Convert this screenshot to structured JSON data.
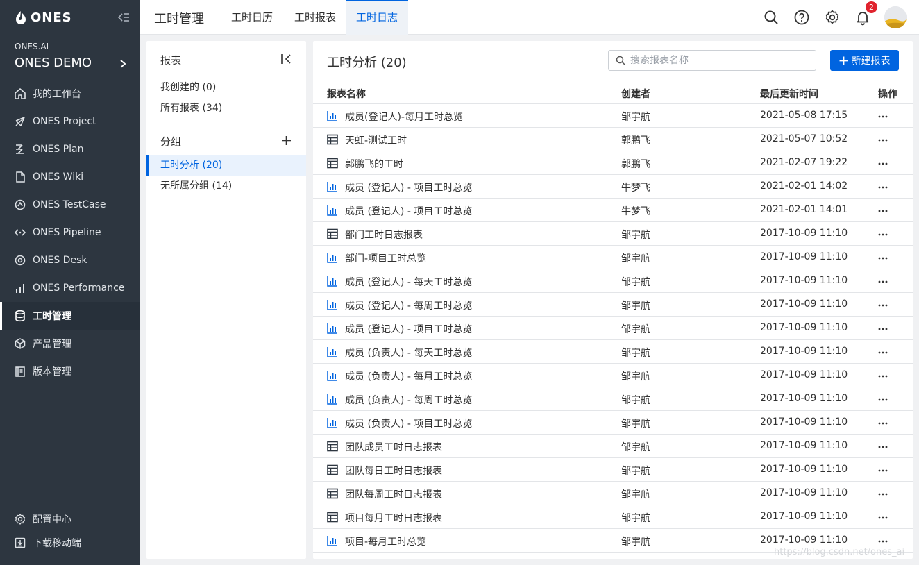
{
  "sidebar": {
    "logo": "ONES",
    "org": "ONES.AI",
    "team": "ONES DEMO",
    "items": [
      {
        "label": "我的工作台",
        "icon": "home-icon"
      },
      {
        "label": "ONES Project",
        "icon": "project-icon"
      },
      {
        "label": "ONES Plan",
        "icon": "plan-icon"
      },
      {
        "label": "ONES Wiki",
        "icon": "wiki-icon"
      },
      {
        "label": "ONES TestCase",
        "icon": "testcase-icon"
      },
      {
        "label": "ONES Pipeline",
        "icon": "pipeline-icon"
      },
      {
        "label": "ONES Desk",
        "icon": "desk-icon"
      },
      {
        "label": "ONES Performance",
        "icon": "performance-icon"
      },
      {
        "label": "工时管理",
        "icon": "database-icon",
        "active": true
      },
      {
        "label": "产品管理",
        "icon": "cube-icon"
      },
      {
        "label": "版本管理",
        "icon": "version-icon"
      }
    ],
    "bottom": [
      {
        "label": "配置中心",
        "icon": "gear-icon"
      },
      {
        "label": "下载移动端",
        "icon": "download-icon"
      }
    ]
  },
  "topbar": {
    "title": "工时管理",
    "tabs": [
      "工时日历",
      "工时报表",
      "工时日志"
    ],
    "active_tab": 2,
    "notification_count": "2"
  },
  "left_panel": {
    "reports_heading": "报表",
    "mine": "我创建的 (0)",
    "all": "所有报表 (34)",
    "groups_heading": "分组",
    "groups": [
      "工时分析 (20)",
      "无所属分组 (14)"
    ],
    "active_group": 0
  },
  "main": {
    "title": "工时分析 (20)",
    "search_placeholder": "搜索报表名称",
    "new_button": "新建报表",
    "columns": [
      "报表名称",
      "创建者",
      "最后更新时间",
      "操作"
    ],
    "rows": [
      {
        "type": "chart",
        "name": "成员(登记人)-每月工时总览",
        "creator": "邹宇航",
        "updated": "2021-05-08 17:15"
      },
      {
        "type": "table",
        "name": "天虹-测试工时",
        "creator": "郭鹏飞",
        "updated": "2021-05-07 10:52"
      },
      {
        "type": "table",
        "name": "郭鹏飞的工时",
        "creator": "郭鹏飞",
        "updated": "2021-02-07 19:22"
      },
      {
        "type": "chart",
        "name": "成员 (登记人) - 项目工时总览",
        "creator": "牛梦飞",
        "updated": "2021-02-01 14:02"
      },
      {
        "type": "chart",
        "name": "成员 (登记人) - 项目工时总览",
        "creator": "牛梦飞",
        "updated": "2021-02-01 14:01"
      },
      {
        "type": "table",
        "name": "部门工时日志报表",
        "creator": "邹宇航",
        "updated": "2017-10-09 11:10"
      },
      {
        "type": "chart",
        "name": "部门-项目工时总览",
        "creator": "邹宇航",
        "updated": "2017-10-09 11:10"
      },
      {
        "type": "chart",
        "name": "成员 (登记人) - 每天工时总览",
        "creator": "邹宇航",
        "updated": "2017-10-09 11:10"
      },
      {
        "type": "chart",
        "name": "成员 (登记人) - 每周工时总览",
        "creator": "邹宇航",
        "updated": "2017-10-09 11:10"
      },
      {
        "type": "chart",
        "name": "成员 (登记人) - 项目工时总览",
        "creator": "邹宇航",
        "updated": "2017-10-09 11:10"
      },
      {
        "type": "chart",
        "name": "成员 (负责人) - 每天工时总览",
        "creator": "邹宇航",
        "updated": "2017-10-09 11:10"
      },
      {
        "type": "chart",
        "name": "成员 (负责人) - 每月工时总览",
        "creator": "邹宇航",
        "updated": "2017-10-09 11:10"
      },
      {
        "type": "chart",
        "name": "成员 (负责人) - 每周工时总览",
        "creator": "邹宇航",
        "updated": "2017-10-09 11:10"
      },
      {
        "type": "chart",
        "name": "成员 (负责人) - 项目工时总览",
        "creator": "邹宇航",
        "updated": "2017-10-09 11:10"
      },
      {
        "type": "table",
        "name": "团队成员工时日志报表",
        "creator": "邹宇航",
        "updated": "2017-10-09 11:10"
      },
      {
        "type": "table",
        "name": "团队每日工时日志报表",
        "creator": "邹宇航",
        "updated": "2017-10-09 11:10"
      },
      {
        "type": "table",
        "name": "团队每周工时日志报表",
        "creator": "邹宇航",
        "updated": "2017-10-09 11:10"
      },
      {
        "type": "table",
        "name": "项目每月工时日志报表",
        "creator": "邹宇航",
        "updated": "2017-10-09 11:10"
      },
      {
        "type": "chart",
        "name": "项目-每月工时总览",
        "creator": "邹宇航",
        "updated": "2017-10-09 11:10"
      }
    ]
  },
  "watermark": "https://blog.csdn.net/ones_ai",
  "colors": {
    "primary": "#0064e0",
    "sidebar": "#2d3640",
    "badge": "#e0232d"
  }
}
